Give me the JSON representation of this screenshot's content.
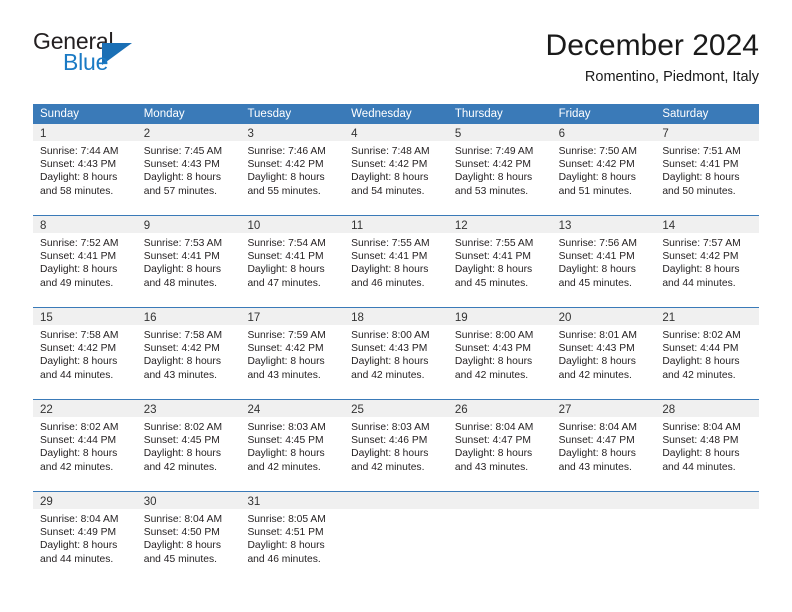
{
  "brand": {
    "name_top": "General",
    "name_bottom": "Blue",
    "triangle_color": "#1a6fb5",
    "text_color": "#231f20",
    "blue_color": "#1a7ac4"
  },
  "header": {
    "title": "December 2024",
    "subtitle": "Romentino, Piedmont, Italy"
  },
  "theme": {
    "header_bar_color": "#3a7ab8",
    "day_band_color": "#f0f0f0",
    "row_rule_color": "#3a7ab8",
    "text_color": "#231f20"
  },
  "weekdays": [
    "Sunday",
    "Monday",
    "Tuesday",
    "Wednesday",
    "Thursday",
    "Friday",
    "Saturday"
  ],
  "weeks": [
    [
      {
        "day": "1",
        "sunrise": "Sunrise: 7:44 AM",
        "sunset": "Sunset: 4:43 PM",
        "daylight_1": "Daylight: 8 hours",
        "daylight_2": "and 58 minutes."
      },
      {
        "day": "2",
        "sunrise": "Sunrise: 7:45 AM",
        "sunset": "Sunset: 4:43 PM",
        "daylight_1": "Daylight: 8 hours",
        "daylight_2": "and 57 minutes."
      },
      {
        "day": "3",
        "sunrise": "Sunrise: 7:46 AM",
        "sunset": "Sunset: 4:42 PM",
        "daylight_1": "Daylight: 8 hours",
        "daylight_2": "and 55 minutes."
      },
      {
        "day": "4",
        "sunrise": "Sunrise: 7:48 AM",
        "sunset": "Sunset: 4:42 PM",
        "daylight_1": "Daylight: 8 hours",
        "daylight_2": "and 54 minutes."
      },
      {
        "day": "5",
        "sunrise": "Sunrise: 7:49 AM",
        "sunset": "Sunset: 4:42 PM",
        "daylight_1": "Daylight: 8 hours",
        "daylight_2": "and 53 minutes."
      },
      {
        "day": "6",
        "sunrise": "Sunrise: 7:50 AM",
        "sunset": "Sunset: 4:42 PM",
        "daylight_1": "Daylight: 8 hours",
        "daylight_2": "and 51 minutes."
      },
      {
        "day": "7",
        "sunrise": "Sunrise: 7:51 AM",
        "sunset": "Sunset: 4:41 PM",
        "daylight_1": "Daylight: 8 hours",
        "daylight_2": "and 50 minutes."
      }
    ],
    [
      {
        "day": "8",
        "sunrise": "Sunrise: 7:52 AM",
        "sunset": "Sunset: 4:41 PM",
        "daylight_1": "Daylight: 8 hours",
        "daylight_2": "and 49 minutes."
      },
      {
        "day": "9",
        "sunrise": "Sunrise: 7:53 AM",
        "sunset": "Sunset: 4:41 PM",
        "daylight_1": "Daylight: 8 hours",
        "daylight_2": "and 48 minutes."
      },
      {
        "day": "10",
        "sunrise": "Sunrise: 7:54 AM",
        "sunset": "Sunset: 4:41 PM",
        "daylight_1": "Daylight: 8 hours",
        "daylight_2": "and 47 minutes."
      },
      {
        "day": "11",
        "sunrise": "Sunrise: 7:55 AM",
        "sunset": "Sunset: 4:41 PM",
        "daylight_1": "Daylight: 8 hours",
        "daylight_2": "and 46 minutes."
      },
      {
        "day": "12",
        "sunrise": "Sunrise: 7:55 AM",
        "sunset": "Sunset: 4:41 PM",
        "daylight_1": "Daylight: 8 hours",
        "daylight_2": "and 45 minutes."
      },
      {
        "day": "13",
        "sunrise": "Sunrise: 7:56 AM",
        "sunset": "Sunset: 4:41 PM",
        "daylight_1": "Daylight: 8 hours",
        "daylight_2": "and 45 minutes."
      },
      {
        "day": "14",
        "sunrise": "Sunrise: 7:57 AM",
        "sunset": "Sunset: 4:42 PM",
        "daylight_1": "Daylight: 8 hours",
        "daylight_2": "and 44 minutes."
      }
    ],
    [
      {
        "day": "15",
        "sunrise": "Sunrise: 7:58 AM",
        "sunset": "Sunset: 4:42 PM",
        "daylight_1": "Daylight: 8 hours",
        "daylight_2": "and 44 minutes."
      },
      {
        "day": "16",
        "sunrise": "Sunrise: 7:58 AM",
        "sunset": "Sunset: 4:42 PM",
        "daylight_1": "Daylight: 8 hours",
        "daylight_2": "and 43 minutes."
      },
      {
        "day": "17",
        "sunrise": "Sunrise: 7:59 AM",
        "sunset": "Sunset: 4:42 PM",
        "daylight_1": "Daylight: 8 hours",
        "daylight_2": "and 43 minutes."
      },
      {
        "day": "18",
        "sunrise": "Sunrise: 8:00 AM",
        "sunset": "Sunset: 4:43 PM",
        "daylight_1": "Daylight: 8 hours",
        "daylight_2": "and 42 minutes."
      },
      {
        "day": "19",
        "sunrise": "Sunrise: 8:00 AM",
        "sunset": "Sunset: 4:43 PM",
        "daylight_1": "Daylight: 8 hours",
        "daylight_2": "and 42 minutes."
      },
      {
        "day": "20",
        "sunrise": "Sunrise: 8:01 AM",
        "sunset": "Sunset: 4:43 PM",
        "daylight_1": "Daylight: 8 hours",
        "daylight_2": "and 42 minutes."
      },
      {
        "day": "21",
        "sunrise": "Sunrise: 8:02 AM",
        "sunset": "Sunset: 4:44 PM",
        "daylight_1": "Daylight: 8 hours",
        "daylight_2": "and 42 minutes."
      }
    ],
    [
      {
        "day": "22",
        "sunrise": "Sunrise: 8:02 AM",
        "sunset": "Sunset: 4:44 PM",
        "daylight_1": "Daylight: 8 hours",
        "daylight_2": "and 42 minutes."
      },
      {
        "day": "23",
        "sunrise": "Sunrise: 8:02 AM",
        "sunset": "Sunset: 4:45 PM",
        "daylight_1": "Daylight: 8 hours",
        "daylight_2": "and 42 minutes."
      },
      {
        "day": "24",
        "sunrise": "Sunrise: 8:03 AM",
        "sunset": "Sunset: 4:45 PM",
        "daylight_1": "Daylight: 8 hours",
        "daylight_2": "and 42 minutes."
      },
      {
        "day": "25",
        "sunrise": "Sunrise: 8:03 AM",
        "sunset": "Sunset: 4:46 PM",
        "daylight_1": "Daylight: 8 hours",
        "daylight_2": "and 42 minutes."
      },
      {
        "day": "26",
        "sunrise": "Sunrise: 8:04 AM",
        "sunset": "Sunset: 4:47 PM",
        "daylight_1": "Daylight: 8 hours",
        "daylight_2": "and 43 minutes."
      },
      {
        "day": "27",
        "sunrise": "Sunrise: 8:04 AM",
        "sunset": "Sunset: 4:47 PM",
        "daylight_1": "Daylight: 8 hours",
        "daylight_2": "and 43 minutes."
      },
      {
        "day": "28",
        "sunrise": "Sunrise: 8:04 AM",
        "sunset": "Sunset: 4:48 PM",
        "daylight_1": "Daylight: 8 hours",
        "daylight_2": "and 44 minutes."
      }
    ],
    [
      {
        "day": "29",
        "sunrise": "Sunrise: 8:04 AM",
        "sunset": "Sunset: 4:49 PM",
        "daylight_1": "Daylight: 8 hours",
        "daylight_2": "and 44 minutes."
      },
      {
        "day": "30",
        "sunrise": "Sunrise: 8:04 AM",
        "sunset": "Sunset: 4:50 PM",
        "daylight_1": "Daylight: 8 hours",
        "daylight_2": "and 45 minutes."
      },
      {
        "day": "31",
        "sunrise": "Sunrise: 8:05 AM",
        "sunset": "Sunset: 4:51 PM",
        "daylight_1": "Daylight: 8 hours",
        "daylight_2": "and 46 minutes."
      },
      {
        "day": "",
        "sunrise": "",
        "sunset": "",
        "daylight_1": "",
        "daylight_2": ""
      },
      {
        "day": "",
        "sunrise": "",
        "sunset": "",
        "daylight_1": "",
        "daylight_2": ""
      },
      {
        "day": "",
        "sunrise": "",
        "sunset": "",
        "daylight_1": "",
        "daylight_2": ""
      },
      {
        "day": "",
        "sunrise": "",
        "sunset": "",
        "daylight_1": "",
        "daylight_2": ""
      }
    ]
  ]
}
